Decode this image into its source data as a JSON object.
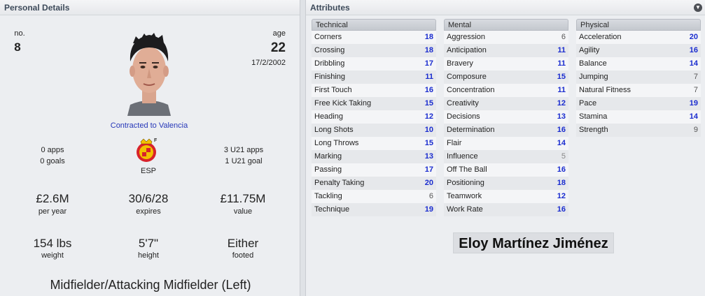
{
  "personal": {
    "header": "Personal Details",
    "no_label": "no.",
    "no_value": "8",
    "age_label": "age",
    "age_value": "22",
    "dob": "17/2/2002",
    "contract": "Contracted to Valencia",
    "apps": "0 apps",
    "goals": "0 goals",
    "nation": "ESP",
    "u21_apps": "3 U21 apps",
    "u21_goals": "1 U21 goal",
    "wage": "£2.6M",
    "wage_label": "per year",
    "expires": "30/6/28",
    "expires_label": "expires",
    "value": "£11.75M",
    "value_label": "value",
    "weight": "154 lbs",
    "weight_label": "weight",
    "height": "5'7\"",
    "height_label": "height",
    "foot": "Either",
    "foot_label": "footed",
    "position": "Midfielder/Attacking Midfielder (Left)"
  },
  "attributes": {
    "header": "Attributes",
    "technical": {
      "title": "Technical",
      "items": [
        {
          "name": "Corners",
          "value": "18"
        },
        {
          "name": "Crossing",
          "value": "18"
        },
        {
          "name": "Dribbling",
          "value": "17"
        },
        {
          "name": "Finishing",
          "value": "11"
        },
        {
          "name": "First Touch",
          "value": "16"
        },
        {
          "name": "Free Kick Taking",
          "value": "15"
        },
        {
          "name": "Heading",
          "value": "12"
        },
        {
          "name": "Long Shots",
          "value": "10"
        },
        {
          "name": "Long Throws",
          "value": "15"
        },
        {
          "name": "Marking",
          "value": "13"
        },
        {
          "name": "Passing",
          "value": "17"
        },
        {
          "name": "Penalty Taking",
          "value": "20"
        },
        {
          "name": "Tackling",
          "value": "6"
        },
        {
          "name": "Technique",
          "value": "19"
        }
      ]
    },
    "mental": {
      "title": "Mental",
      "items": [
        {
          "name": "Aggression",
          "value": "6"
        },
        {
          "name": "Anticipation",
          "value": "11"
        },
        {
          "name": "Bravery",
          "value": "11"
        },
        {
          "name": "Composure",
          "value": "15"
        },
        {
          "name": "Concentration",
          "value": "11"
        },
        {
          "name": "Creativity",
          "value": "12"
        },
        {
          "name": "Decisions",
          "value": "13"
        },
        {
          "name": "Determination",
          "value": "16"
        },
        {
          "name": "Flair",
          "value": "14"
        },
        {
          "name": "Influence",
          "value": "5"
        },
        {
          "name": "Off The Ball",
          "value": "16"
        },
        {
          "name": "Positioning",
          "value": "18"
        },
        {
          "name": "Teamwork",
          "value": "12"
        },
        {
          "name": "Work Rate",
          "value": "16"
        }
      ]
    },
    "physical": {
      "title": "Physical",
      "items": [
        {
          "name": "Acceleration",
          "value": "20"
        },
        {
          "name": "Agility",
          "value": "16"
        },
        {
          "name": "Balance",
          "value": "14"
        },
        {
          "name": "Jumping",
          "value": "7"
        },
        {
          "name": "Natural Fitness",
          "value": "7"
        },
        {
          "name": "Pace",
          "value": "19"
        },
        {
          "name": "Stamina",
          "value": "14"
        },
        {
          "name": "Strength",
          "value": "9"
        }
      ]
    }
  },
  "player_name": "Eloy Martínez Jiménez",
  "icons": {
    "dropdown": "chevron-down-icon",
    "face": "player-face-icon",
    "badge": "federation-badge-icon"
  },
  "colors": {
    "high_value": "#1a2ccf",
    "mid_value": "#555555",
    "low_value": "#888888",
    "contract_link": "#2637b8"
  }
}
